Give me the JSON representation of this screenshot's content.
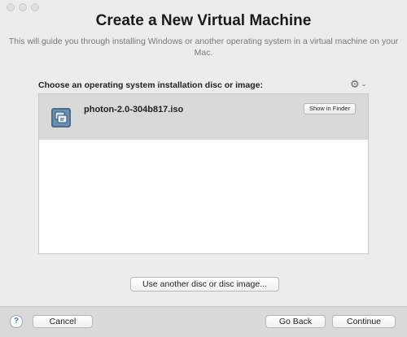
{
  "dialog": {
    "title": "Create a New Virtual Machine",
    "subtitle": "This will guide you through installing Windows or another operating system in a virtual machine on your Mac."
  },
  "disc_section": {
    "label": "Choose an operating system installation disc or image:",
    "gear_icon": "⚙",
    "chevron_icon": "⌄",
    "items": [
      {
        "name": "photon-2.0-304b817.iso",
        "icon": "disc-image-icon",
        "show_in_finder_label": "Show in Finder"
      }
    ]
  },
  "another_disc_label": "Use another disc or disc image...",
  "footer": {
    "help_label": "?",
    "cancel_label": "Cancel",
    "go_back_label": "Go Back",
    "continue_label": "Continue"
  }
}
